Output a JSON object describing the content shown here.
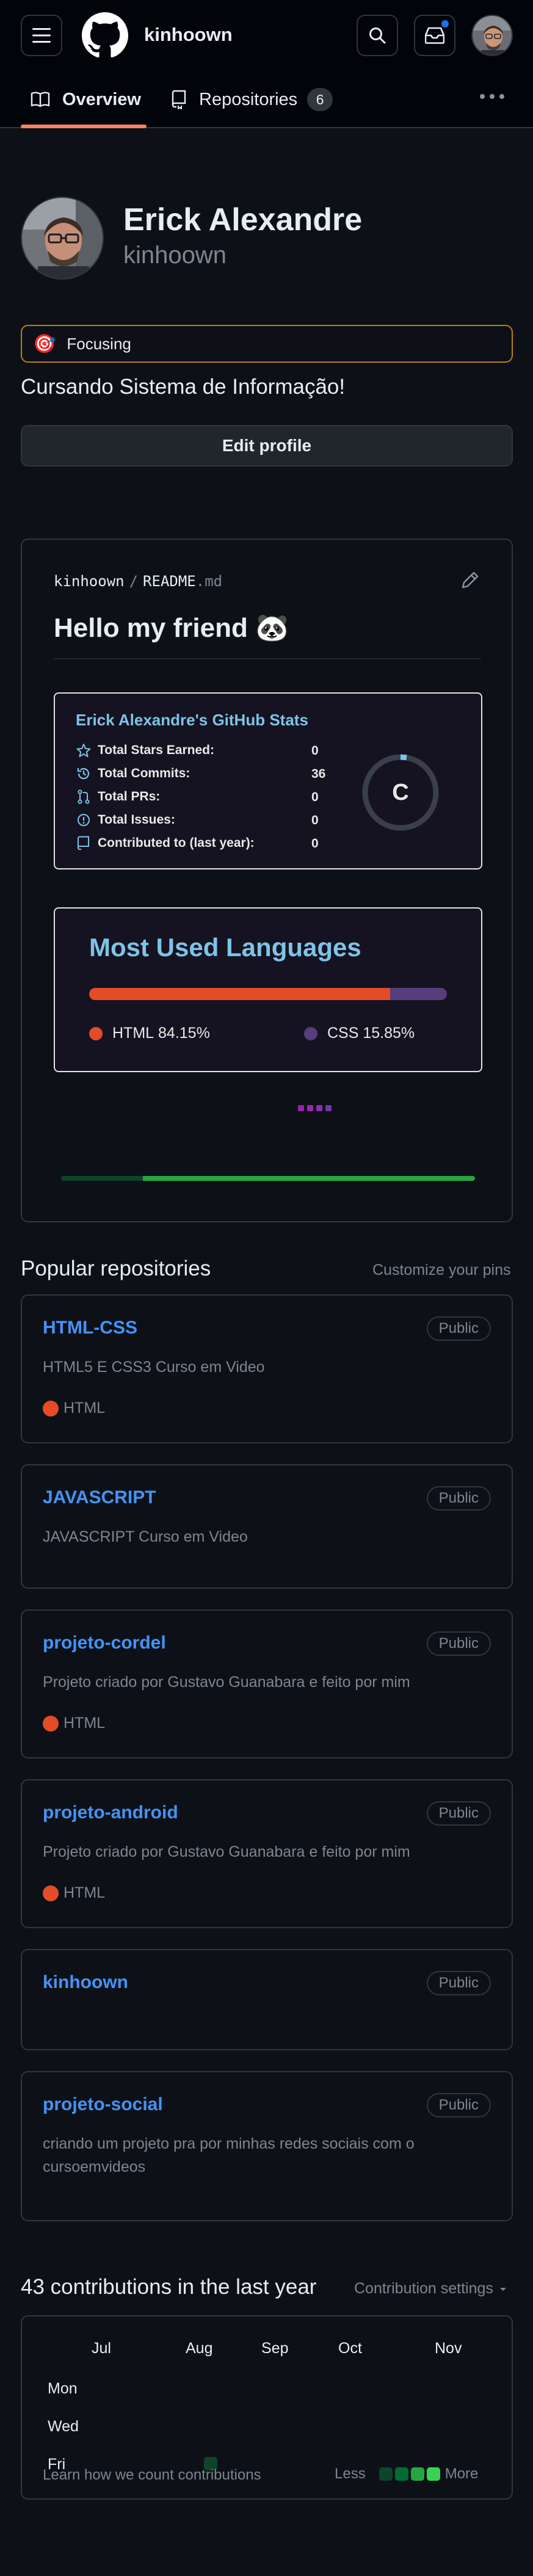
{
  "header": {
    "username": "kinhoown",
    "menu_icon": "hamburger-icon",
    "logo_icon": "github-logo",
    "search_icon": "search-icon",
    "inbox_icon": "inbox-icon"
  },
  "tabs": [
    {
      "label": "Overview",
      "icon": "book-icon",
      "active": true
    },
    {
      "label": "Repositories",
      "icon": "repo-icon",
      "count": "6"
    }
  ],
  "profile": {
    "name": "Erick Alexandre",
    "login": "kinhoown",
    "status_emoji": "🎯",
    "status_text": "Focusing",
    "bio": "Cursando Sistema de Informação!",
    "edit_label": "Edit profile"
  },
  "readme": {
    "owner": "kinhoown",
    "separator": "/",
    "file": "README",
    "ext": ".md",
    "heading": "Hello my friend 🐼",
    "stats": {
      "title": "Erick Alexandre's GitHub Stats",
      "rank": "C",
      "rows": [
        {
          "label": "Total Stars Earned:",
          "value": "0",
          "icon": "star-icon"
        },
        {
          "label": "Total Commits:",
          "value": "36",
          "icon": "history-icon"
        },
        {
          "label": "Total PRs:",
          "value": "0",
          "icon": "pull-request-icon"
        },
        {
          "label": "Total Issues:",
          "value": "0",
          "icon": "issue-icon"
        },
        {
          "label": "Contributed to (last year):",
          "value": "0",
          "icon": "repo-icon"
        }
      ]
    },
    "languages": {
      "title": "Most Used Languages",
      "items": [
        {
          "name": "HTML",
          "percent_label": "84.15%",
          "percent": 84.15,
          "color": "#e34c26"
        },
        {
          "name": "CSS",
          "percent_label": "15.85%",
          "percent": 15.85,
          "color": "#563d7c"
        }
      ]
    }
  },
  "popular": {
    "title": "Popular repositories",
    "customize": "Customize your pins",
    "repos": [
      {
        "name": "HTML-CSS",
        "visibility": "Public",
        "desc": "HTML5 E CSS3 Curso em Video",
        "lang": "HTML"
      },
      {
        "name": "JAVASCRIPT",
        "visibility": "Public",
        "desc": "JAVASCRIPT Curso em Video",
        "lang": ""
      },
      {
        "name": "projeto-cordel",
        "visibility": "Public",
        "desc": "Projeto criado por Gustavo Guanabara e feito por mim",
        "lang": "HTML"
      },
      {
        "name": "projeto-android",
        "visibility": "Public",
        "desc": "Projeto criado por Gustavo Guanabara e feito por mim",
        "lang": "HTML"
      },
      {
        "name": "kinhoown",
        "visibility": "Public",
        "desc": "",
        "lang": ""
      },
      {
        "name": "projeto-social",
        "visibility": "Public",
        "desc": "criando um projeto pra por minhas redes sociais com o cursoemvideos",
        "lang": ""
      }
    ],
    "lang_color": "#e34c26"
  },
  "contributions": {
    "title": "43 contributions in the last year",
    "settings": "Contribution settings",
    "months": [
      "Jul",
      "Aug",
      "Sep",
      "Oct",
      "Nov"
    ],
    "weekdays": [
      "Mon",
      "Wed",
      "Fri"
    ],
    "learn": "Learn how we count contributions",
    "less": "Less",
    "more": "More",
    "legend_colors": [
      "#0e4429",
      "#006d32",
      "#26a641",
      "#39d353"
    ]
  }
}
